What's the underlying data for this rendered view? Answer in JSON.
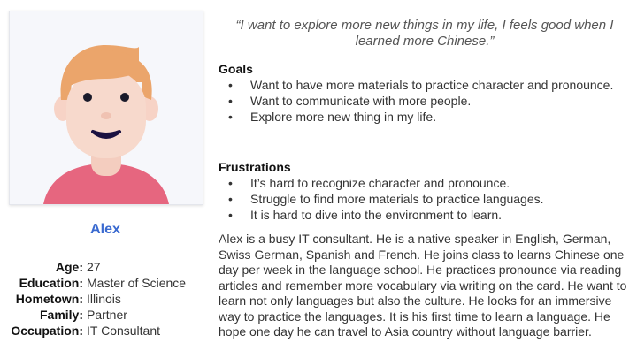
{
  "persona": {
    "name": "Alex",
    "avatar_icon": "male-avatar-illustration",
    "details": [
      {
        "label": "Age:",
        "value": "27"
      },
      {
        "label": "Education:",
        "value": "Master of Science"
      },
      {
        "label": "Hometown:",
        "value": "Illinois"
      },
      {
        "label": "Family:",
        "value": "Partner"
      },
      {
        "label": "Occupation:",
        "value": "IT Consultant"
      }
    ]
  },
  "quote": "“I want to explore more new things in my life, I feels good when I learned more Chinese.”",
  "goals": {
    "title": "Goals",
    "items": [
      "Want to have more materials to practice character and pronounce.",
      "Want to communicate with more people.",
      "Explore more new thing in my life."
    ]
  },
  "frustrations": {
    "title": "Frustrations",
    "items": [
      "It’s hard to recognize character and pronounce.",
      "Struggle to find more materials to practice languages.",
      "It is hard to dive into the environment to learn."
    ]
  },
  "bio": "Alex is a busy IT consultant. He is a native speaker in English, German, Swiss German, Spanish and French. He joins class to learns Chinese one day per week in the language school. He practices pronounce via reading articles and remember more vocabulary via writing on the card. He want to learn not only languages but also the culture. He looks for an immersive way to practice the languages. It is his first time to learn a language. He hope one day he can travel to Asia country without language barrier.",
  "colors": {
    "name_accent": "#3a6ad0",
    "skin": "#f7d9cc",
    "hair": "#eba56b",
    "shirt": "#e6667f",
    "card_bg": "#f6f7fb"
  }
}
